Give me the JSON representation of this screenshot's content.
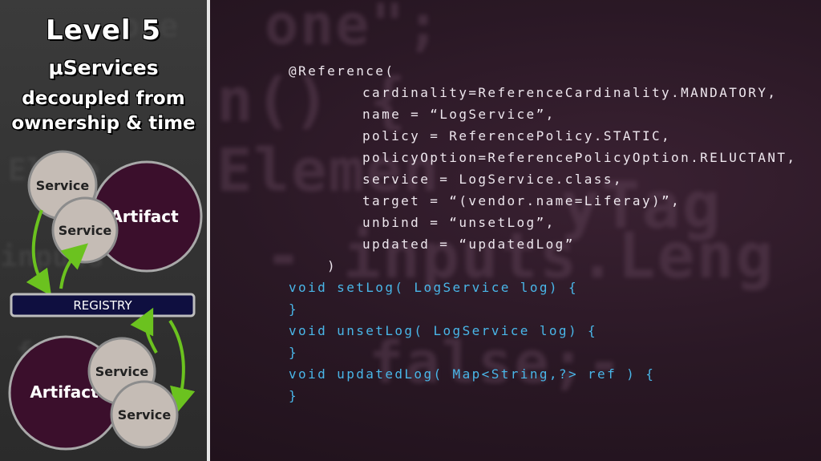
{
  "left_panel": {
    "title": "Level 5",
    "subtitle_1": "µServices",
    "subtitle_2": "decoupled from",
    "subtitle_3": "ownership & time"
  },
  "diagram": {
    "top_artifact": "Artifact",
    "top_service_1": "Service",
    "top_service_2": "Service",
    "registry": "REGISTRY",
    "bottom_artifact": "Artifact",
    "bottom_service_1": "Service",
    "bottom_service_2": "Service",
    "colors": {
      "artifact": "#3b0f2c",
      "service": "#c5bcb5",
      "arrow": "#6bc21f",
      "registry": "#0f0f40"
    }
  },
  "code": {
    "lines": [
      "@Reference(",
      "cardinality=ReferenceCardinality.MANDATORY,",
      "name = “LogService”,",
      "policy = ReferencePolicy.STATIC,",
      "policyOption=ReferencePolicyOption.RELUCTANT,",
      "service = LogService.class,",
      "target = “(vendor.name=Liferay)”,",
      "unbind = “unsetLog”,",
      "updated = “updatedLog”",
      ")",
      "void setLog( LogService log) {",
      "}",
      "void unsetLog( LogService log) {",
      "}",
      "void updatedLog( Map<String,?> ref ) {",
      "}"
    ],
    "colors": {
      "annotation": "#eee7ee",
      "method": "#49b6e8"
    }
  }
}
